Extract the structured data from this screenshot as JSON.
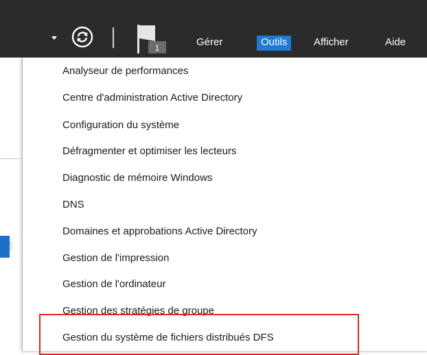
{
  "header": {
    "menus": [
      {
        "label": "Gérer",
        "active": false
      },
      {
        "label": "Outils",
        "active": true
      },
      {
        "label": "Afficher",
        "active": false
      },
      {
        "label": "Aide",
        "active": false
      }
    ],
    "notification_count": "1",
    "icons": [
      "chevron-down-icon",
      "refresh-icon",
      "flag-icon"
    ]
  },
  "tools_menu": {
    "items": [
      "Analyseur de performances",
      "Centre d'administration Active Directory",
      "Configuration du système",
      "Défragmenter et optimiser les lecteurs",
      "Diagnostic de mémoire Windows",
      "DNS",
      "Domaines et approbations Active Directory",
      "Gestion de l'impression",
      "Gestion de l'ordinateur",
      "Gestion des stratégies de groupe",
      "Gestion du système de fichiers distribués DFS"
    ]
  },
  "colors": {
    "header_bg": "#2b2b2b",
    "active_menu": "#1d7bd6",
    "annotation_box": "#e0261c"
  }
}
